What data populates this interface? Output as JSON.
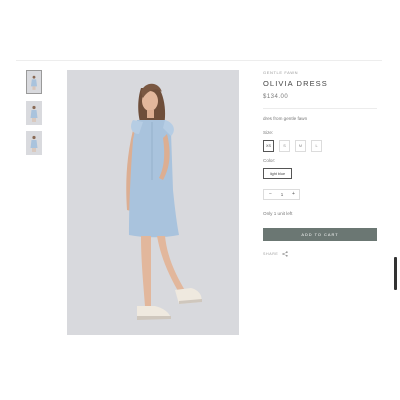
{
  "gallery": {
    "thumbnails": [
      "thumbnail-1",
      "thumbnail-2",
      "thumbnail-3"
    ],
    "active_index": 0,
    "main_image_alt": "OLIVIA DRESS"
  },
  "product": {
    "brand": "GENTLE FAWN",
    "title": "OLIVIA DRESS",
    "price": "$134.00",
    "description": "dres from gentle fawn"
  },
  "size": {
    "label": "Size:",
    "options": [
      "XS",
      "S",
      "M",
      "L"
    ],
    "selected": "XS"
  },
  "color": {
    "label": "Color:",
    "selected": "light blue"
  },
  "quantity": {
    "minus": "−",
    "value": "1",
    "plus": "+"
  },
  "stock_text": "Only 1 unit left",
  "add_to_cart_label": "ADD TO CART",
  "share": {
    "label": "SHARE",
    "icon": "share-icon"
  },
  "colors": {
    "button_bg": "#6b7773",
    "image_bg": "#d8d9dd",
    "dress": "#a9c3dd"
  }
}
